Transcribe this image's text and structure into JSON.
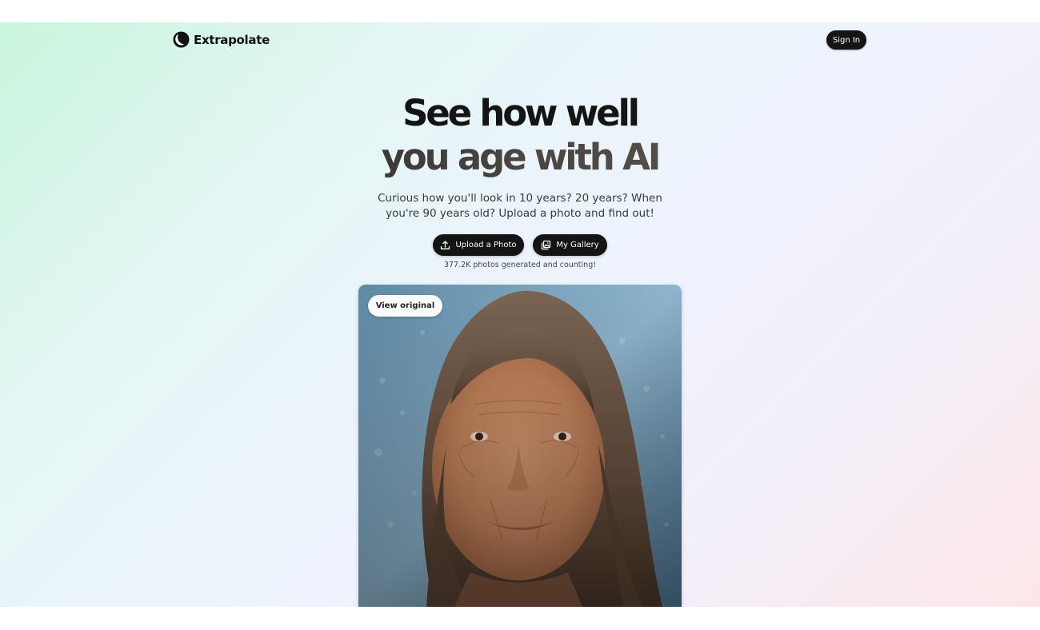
{
  "nav": {
    "brand": "Extrapolate",
    "brand_icon": "moon-logo-icon",
    "sign_in_label": "Sign In"
  },
  "hero": {
    "headline_line1": "See how well",
    "headline_line2": "you age with AI",
    "subtitle": "Curious how you'll look in 10 years? 20 years? When you're 90 years old? Upload a photo and find out!",
    "upload_label": "Upload a Photo",
    "upload_icon": "upload-icon",
    "gallery_label": "My Gallery",
    "gallery_icon": "gallery-icon",
    "counter_text": "377.2K photos generated and counting!"
  },
  "preview": {
    "view_original_label": "View original",
    "image_subject": "aged-portrait-photo"
  },
  "colors": {
    "button_bg": "#141414",
    "button_text": "#ffffff",
    "gradient_start": "#c9f6dd",
    "gradient_end": "#fde6e8"
  }
}
